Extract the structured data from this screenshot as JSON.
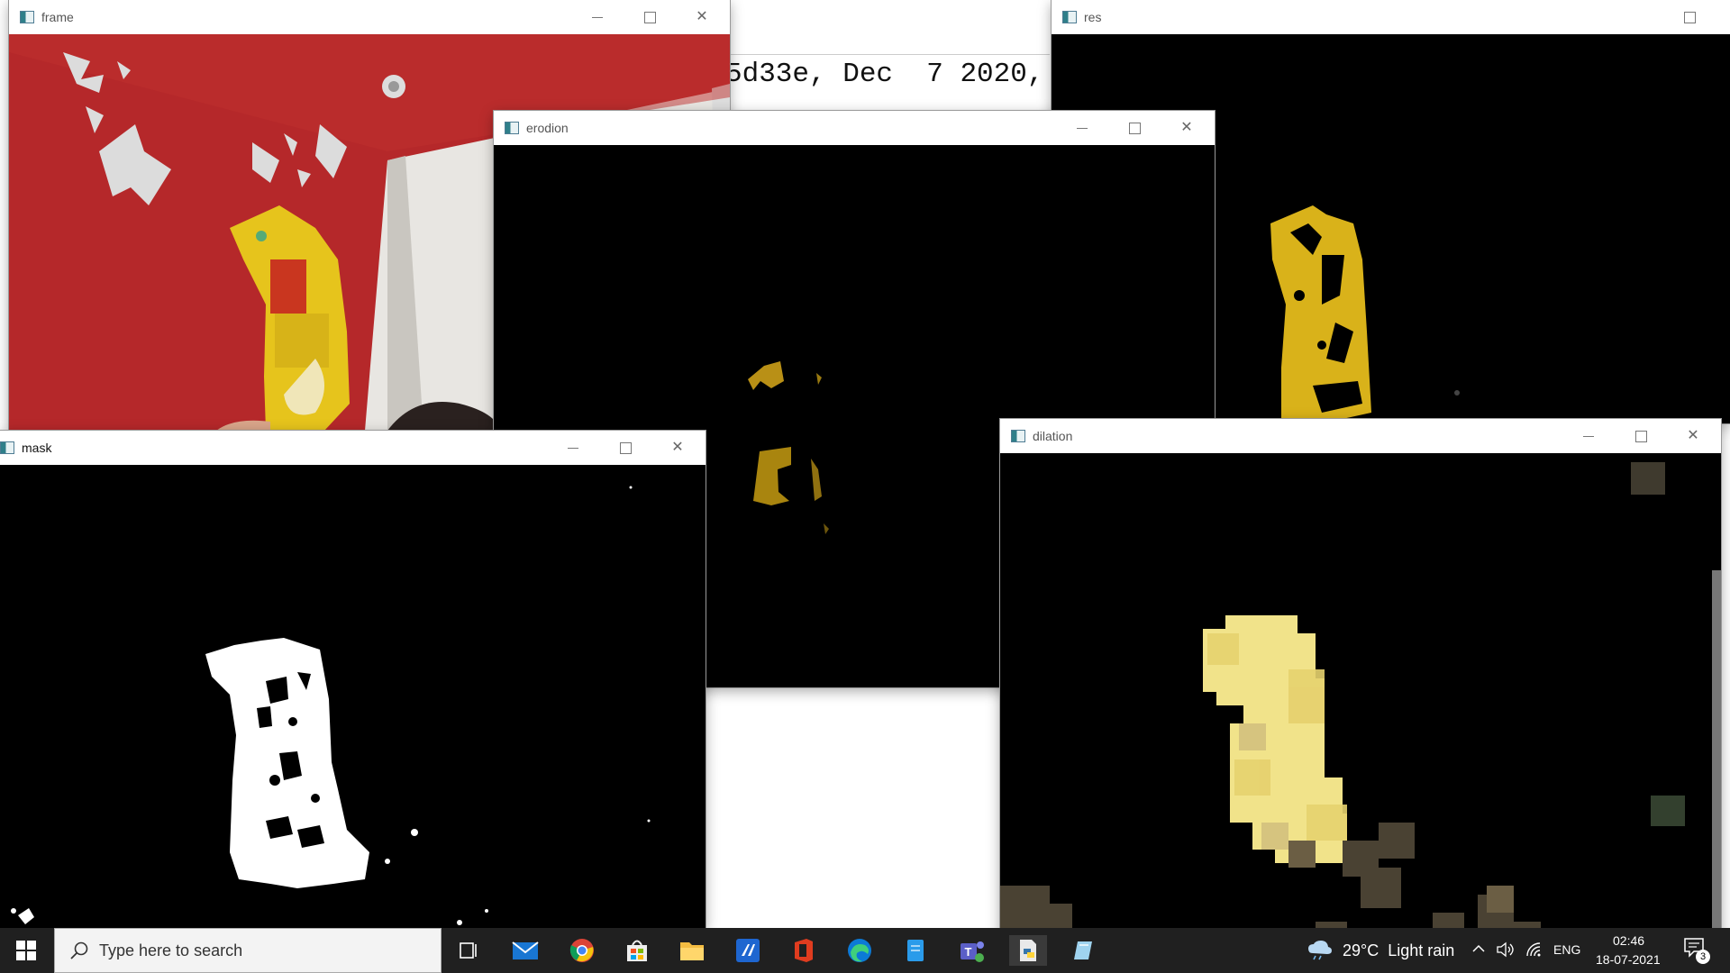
{
  "background_console": {
    "text": "5d33e, Dec  7 2020,"
  },
  "windows": {
    "frame": {
      "title": "frame"
    },
    "res": {
      "title": "res"
    },
    "erosion": {
      "title": "erodion"
    },
    "mask": {
      "title": "mask"
    },
    "dilation": {
      "title": "dilation"
    }
  },
  "taskbar": {
    "search_placeholder": "Type here to search",
    "weather": "29°C  Light rain",
    "language": "ENG",
    "time": "02:46",
    "date": "18-07-2021",
    "notification_count": "3",
    "apps": [
      "task-view",
      "mail",
      "chrome",
      "store",
      "file-explorer",
      "visual-studio-code",
      "office",
      "edge",
      "notepad",
      "teams",
      "python",
      "notepad-alt"
    ]
  },
  "colors": {
    "taskbar": "#202020",
    "wall_red": "#b5282a",
    "pack_yellow": "#e6c41c",
    "dilation_yellow": "#f3e58c"
  }
}
